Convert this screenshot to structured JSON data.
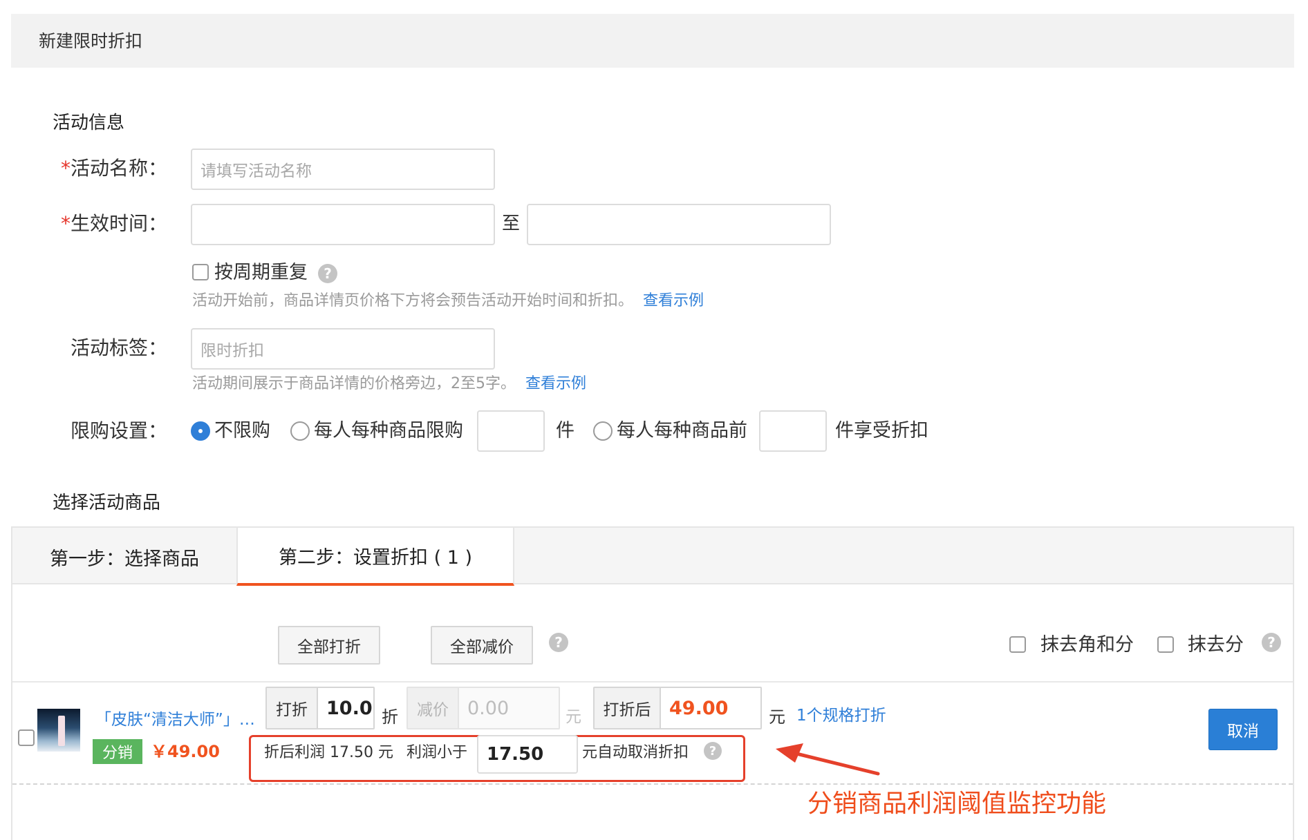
{
  "header": {
    "title": "新建限时折扣"
  },
  "activity_info": {
    "section_title": "活动信息",
    "name": {
      "label": "活动名称：",
      "required_mark": "*",
      "placeholder": "请填写活动名称",
      "value": ""
    },
    "effective_time": {
      "label": "生效时间：",
      "required_mark": "*",
      "start_value": "",
      "to_text": "至",
      "end_value": ""
    },
    "repeat": {
      "label": "按周期重复",
      "checked": false,
      "help_icon": "question-icon"
    },
    "preview_hint": {
      "text": "活动开始前，商品详情页价格下方将会预告活动开始时间和折扣。",
      "link": "查看示例"
    },
    "tag": {
      "label": "活动标签：",
      "placeholder": "限时折扣",
      "value": ""
    },
    "tag_hint": {
      "text": "活动期间展示于商品详情的价格旁边，2至5字。",
      "link": "查看示例"
    },
    "purchase_limit": {
      "label": "限购设置：",
      "options": [
        "不限购",
        "每人每种商品限购",
        "每人每种商品前"
      ],
      "selected": "不限购",
      "unit_1": "件",
      "unit_2": "件享受折扣"
    }
  },
  "products": {
    "section_title": "选择活动商品",
    "tabs": [
      "第一步：选择商品",
      "第二步：设置折扣 ( 1 )"
    ],
    "active_tab": "第二步：设置折扣 ( 1 )",
    "toolbar": {
      "discount_all": "全部打折",
      "reduce_all": "全部减价",
      "round_jiao_fen": "抹去角和分",
      "round_fen": "抹去分"
    },
    "row": {
      "title": "「皮肤“清洁大师”」…",
      "tag": "分销",
      "price": "￥49.00",
      "discount_label": "打折",
      "discount_value": "10.0",
      "discount_unit": "折",
      "reduce_label": "减价",
      "reduce_placeholder": "0.00",
      "reduce_unit": "元",
      "after_label": "打折后",
      "after_value": "49.00",
      "after_unit": "元",
      "spec_link": "1个规格打折",
      "cancel_label": "取消",
      "profit_text": "折后利润 17.50 元",
      "profit_threshold_label": "利润小于",
      "profit_threshold_value": "17.50",
      "profit_suffix": "元自动取消折扣"
    }
  },
  "annotation": {
    "text": "分销商品利润阈值监控功能"
  },
  "colors": {
    "accent_blue": "#2f7fd8",
    "accent_orange": "#f0531f",
    "annotation_red": "#e5402b",
    "tag_green": "#5ab55e"
  }
}
